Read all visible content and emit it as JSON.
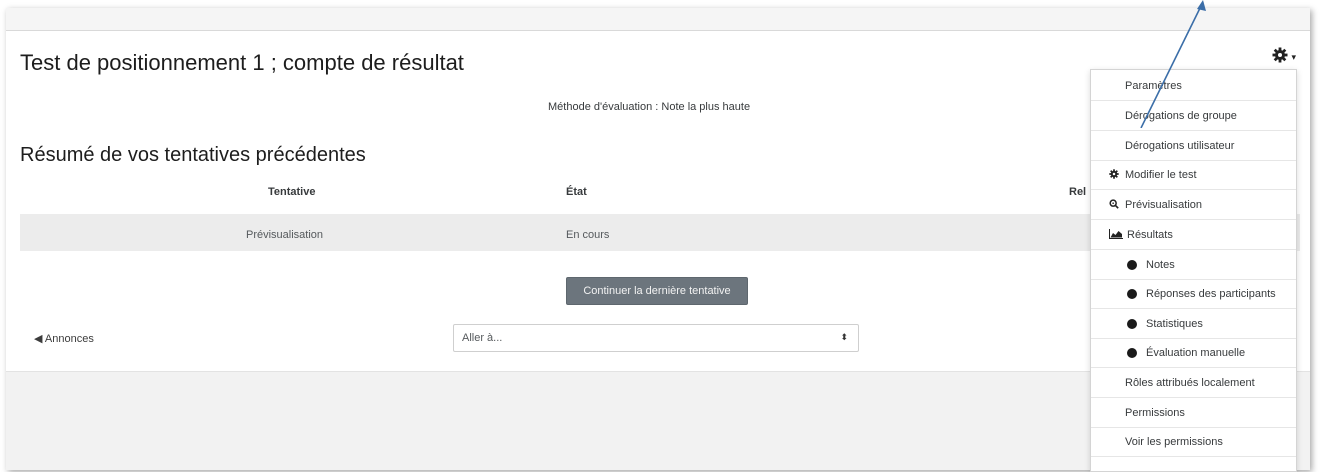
{
  "quiz": {
    "title": "Test de positionnement 1 ; compte de résultat",
    "grading_method": "Méthode d'évaluation : Note la plus haute",
    "summary_heading": "Résumé de vos tentatives précédentes"
  },
  "table": {
    "headers": [
      "Tentative",
      "État",
      "Rel"
    ],
    "rows": [
      {
        "attempt": "Prévisualisation",
        "state": "En cours"
      }
    ]
  },
  "actions": {
    "continue_label": "Continuer la dernière tentative"
  },
  "navigation": {
    "prev_link": "◀ Annonces",
    "jump_placeholder": "Aller à...",
    "jump_arrow": "⬍"
  },
  "admin_menu": {
    "items": [
      {
        "label": "Paramètres",
        "icon": ""
      },
      {
        "label": "Dérogations de groupe",
        "icon": ""
      },
      {
        "label": "Dérogations utilisateur",
        "icon": ""
      },
      {
        "label": "Modifier le test",
        "icon": "gear-icon"
      },
      {
        "label": "Prévisualisation",
        "icon": "zoom-icon"
      },
      {
        "label": "Résultats",
        "icon": "area-chart-icon"
      },
      {
        "label": "Notes",
        "icon": "bullet"
      },
      {
        "label": "Réponses des participants",
        "icon": "bullet"
      },
      {
        "label": "Statistiques",
        "icon": "bullet"
      },
      {
        "label": "Évaluation manuelle",
        "icon": "bullet"
      },
      {
        "label": "Rôles attribués localement",
        "icon": ""
      },
      {
        "label": "Permissions",
        "icon": ""
      },
      {
        "label": "Voir les permissions",
        "icon": ""
      }
    ]
  },
  "colors": {
    "button_bg": "#6c757d",
    "annotation_arrow": "#3b6ea8"
  }
}
